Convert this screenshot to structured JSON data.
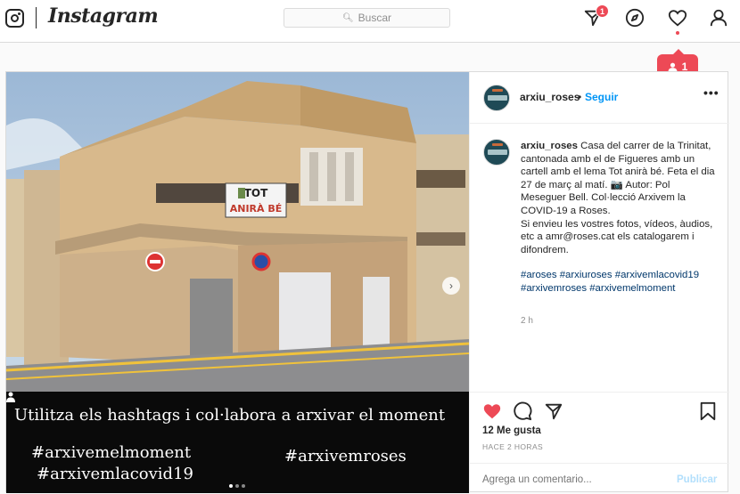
{
  "header": {
    "logo_text": "Instagram",
    "search_placeholder": "Buscar",
    "inbox_badge": "1",
    "icons": [
      "camera-logo-icon",
      "direct-icon",
      "explore-icon",
      "heart-icon",
      "profile-icon"
    ]
  },
  "notification": {
    "count": "1"
  },
  "post": {
    "username": "arxiu_roses",
    "dot": "•",
    "follow_label": "Seguir",
    "more_label": "•••",
    "image_overlay": {
      "title": "Utilitza els hashtags i col·labora a arxivar el moment",
      "tag1": "#arxivemelmoment",
      "tag2": "#arxivemlacovid19",
      "tag3": "#arxivemroses",
      "banner_line1": "TOT",
      "banner_line2": "ANIRÀ BÉ",
      "carousel_total": 3,
      "carousel_active": 1
    },
    "caption_user": "arxiu_roses",
    "caption_text": " Casa del carrer de la Trinitat, cantonada amb el de Figueres amb un cartell amb el lema Tot anirà bé. Feta el dia 27 de març al matí. 📷 Autor: Pol Meseguer Bell. Col·lecció Arxivem la COVID-19 a Roses.",
    "caption_text2": "Si envieu les vostres fotos, vídeos, àudios, etc a amr@roses.cat els catalogarem i difondrem.",
    "hashtags": "#aroses #arxiuroses #arxivemlacovid19 #arxivemroses #arxivemelmoment",
    "comment_time": "2 h",
    "likes": "12 Me gusta",
    "time_ago": "HACE 2 HORAS",
    "comment_placeholder": "Agrega un comentario...",
    "publish_label": "Publicar"
  },
  "colors": {
    "like_red": "#ed4956",
    "link_blue": "#0095f6",
    "border": "#dbdbdb"
  }
}
